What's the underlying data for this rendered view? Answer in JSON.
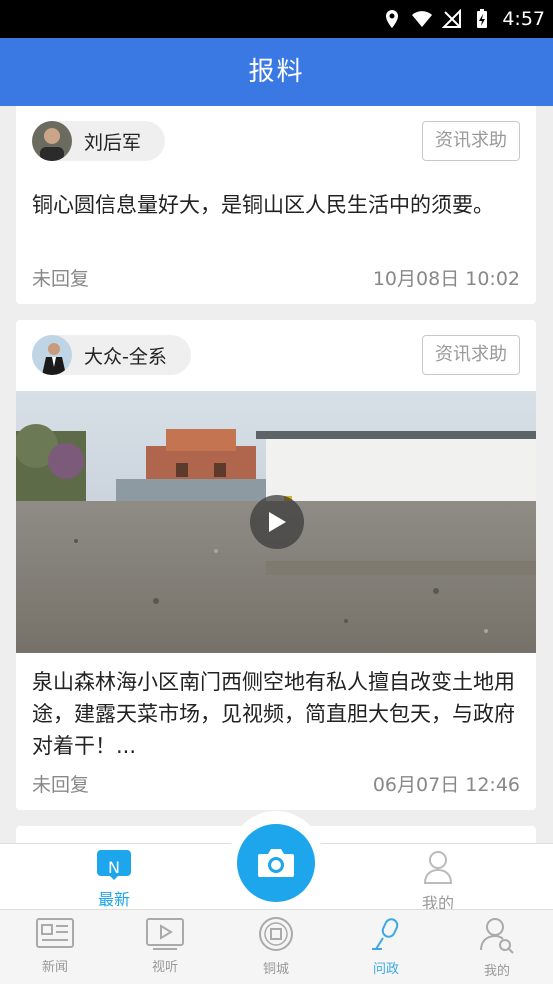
{
  "status_bar": {
    "time": "4:57"
  },
  "header": {
    "title": "报料"
  },
  "posts": [
    {
      "author": "刘后军",
      "tag": "资讯求助",
      "content": "铜心圆信息量好大，是铜山区人民生活中的须要。",
      "status": "未回复",
      "datetime": "10月08日 10:02"
    },
    {
      "author": "大众-全系",
      "tag": "资讯求助",
      "content": "泉山森林海小区南门西侧空地有私人擅自改变土地用途，建露天菜市场，见视频，简直胆大包天，与政府对着干！...",
      "status": "未回复",
      "datetime": "06月07日 12:46"
    }
  ],
  "inner_tabs": {
    "latest": "最新",
    "latest_badge": "N",
    "mine": "我的"
  },
  "bottom_nav": [
    {
      "label": "新闻",
      "icon": "news-icon",
      "active": false
    },
    {
      "label": "视听",
      "icon": "video-icon",
      "active": false
    },
    {
      "label": "铜城",
      "icon": "coin-icon",
      "active": false
    },
    {
      "label": "问政",
      "icon": "microphone-icon",
      "active": true
    },
    {
      "label": "我的",
      "icon": "user-icon",
      "active": false
    }
  ],
  "colors": {
    "header": "#3a78e4",
    "accent": "#1ea6ec",
    "active_nav": "#3aa9e6"
  }
}
